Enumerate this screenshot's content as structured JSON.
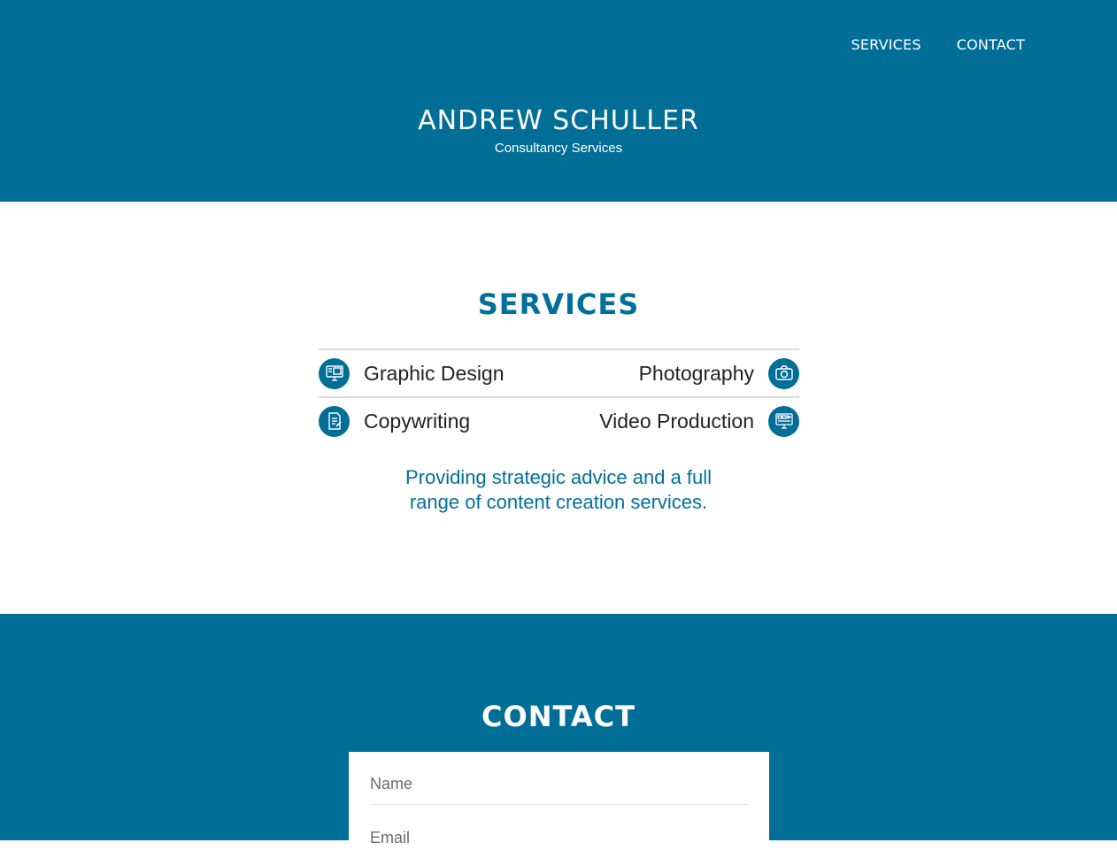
{
  "nav": {
    "items": [
      "SERVICES",
      "CONTACT"
    ]
  },
  "header": {
    "name": "ANDREW SCHULLER",
    "subtitle": "Consultancy Services"
  },
  "services": {
    "title": "SERVICES",
    "rows": [
      {
        "left": {
          "label": "Graphic Design",
          "icon": "monitor-icon"
        },
        "right": {
          "label": "Photography",
          "icon": "camera-icon"
        }
      },
      {
        "left": {
          "label": "Copywriting",
          "icon": "document-icon"
        },
        "right": {
          "label": "Video Production",
          "icon": "video-icon"
        }
      }
    ],
    "tagline_line1": "Providing strategic advice and a full",
    "tagline_line2": "range of content creation services."
  },
  "contact": {
    "title": "CONTACT",
    "name_placeholder": "Name",
    "email_placeholder": "Email"
  },
  "colors": {
    "brand": "#006e96",
    "accent_text": "#00709a",
    "white": "#ffffff"
  }
}
